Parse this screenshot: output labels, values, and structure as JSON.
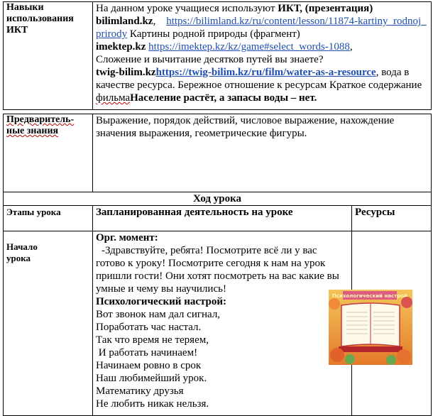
{
  "ict": {
    "label": "Навыки использования ИКТ",
    "line1_prefix": "На данном уроке учащиеся  используют ",
    "line1_bold": "ИКТ, (презентация)",
    "site1": "bilimland.kz",
    "url1": "https://bilimland.kz/ru/content/lesson/11874-kartiny_rodnoj_prirody",
    "desc1": " Картины родной природы (фрагмент)",
    "site2": "imektep.kz",
    "url2": "https://imektep.kz/kz/game#select_words-1088",
    "desc2": "Сложение и вычитание десятков путей вы знаете?",
    "site3": "twig-bilim.kz",
    "url3": "https://twig-bilim.kz/ru/film/water-as-a-resource",
    "desc3": ", вода в качестве ресурса. Бережное отношение к ресурсам Краткое содержание ",
    "film_word": "фильма",
    "desc3_bold": "Население растёт, а запасы воды – нет."
  },
  "prior": {
    "label": "Предваритель-ные знания",
    "text": "Выражение, порядок действий, числовое выражение, нахождение значения выражения, геометрические фигуры."
  },
  "lesson": {
    "title": "Ход урока",
    "col_stages": "Этапы урока",
    "col_activity": "Запланированная деятельность на уроке",
    "col_resources": "Ресурсы",
    "stage": "Начало урока",
    "org_title": "Орг. момент:",
    "org_text": "-Здравствуйте, ребята! Посмотрите всё ли у вас готово к уроку! Посмотрите сегодня к нам на урок пришли гости! Они хотят посмотреть на вас какие вы умные и чему вы  научились!",
    "psy_title": "Психологический настрой:",
    "poem": [
      "Вот звонок нам дал сигнал,",
      "Поработать час настал.",
      "Так что время не теряем,",
      " И работать начинаем!",
      "Начинаем ровно в срок",
      "Наш любимейший урок.",
      "Математику друзья",
      "Не любить никак нельзя."
    ],
    "resource_image_title": "Психологический настрой"
  },
  "colors": {
    "link": "#1f4fb0",
    "border": "#000000"
  }
}
